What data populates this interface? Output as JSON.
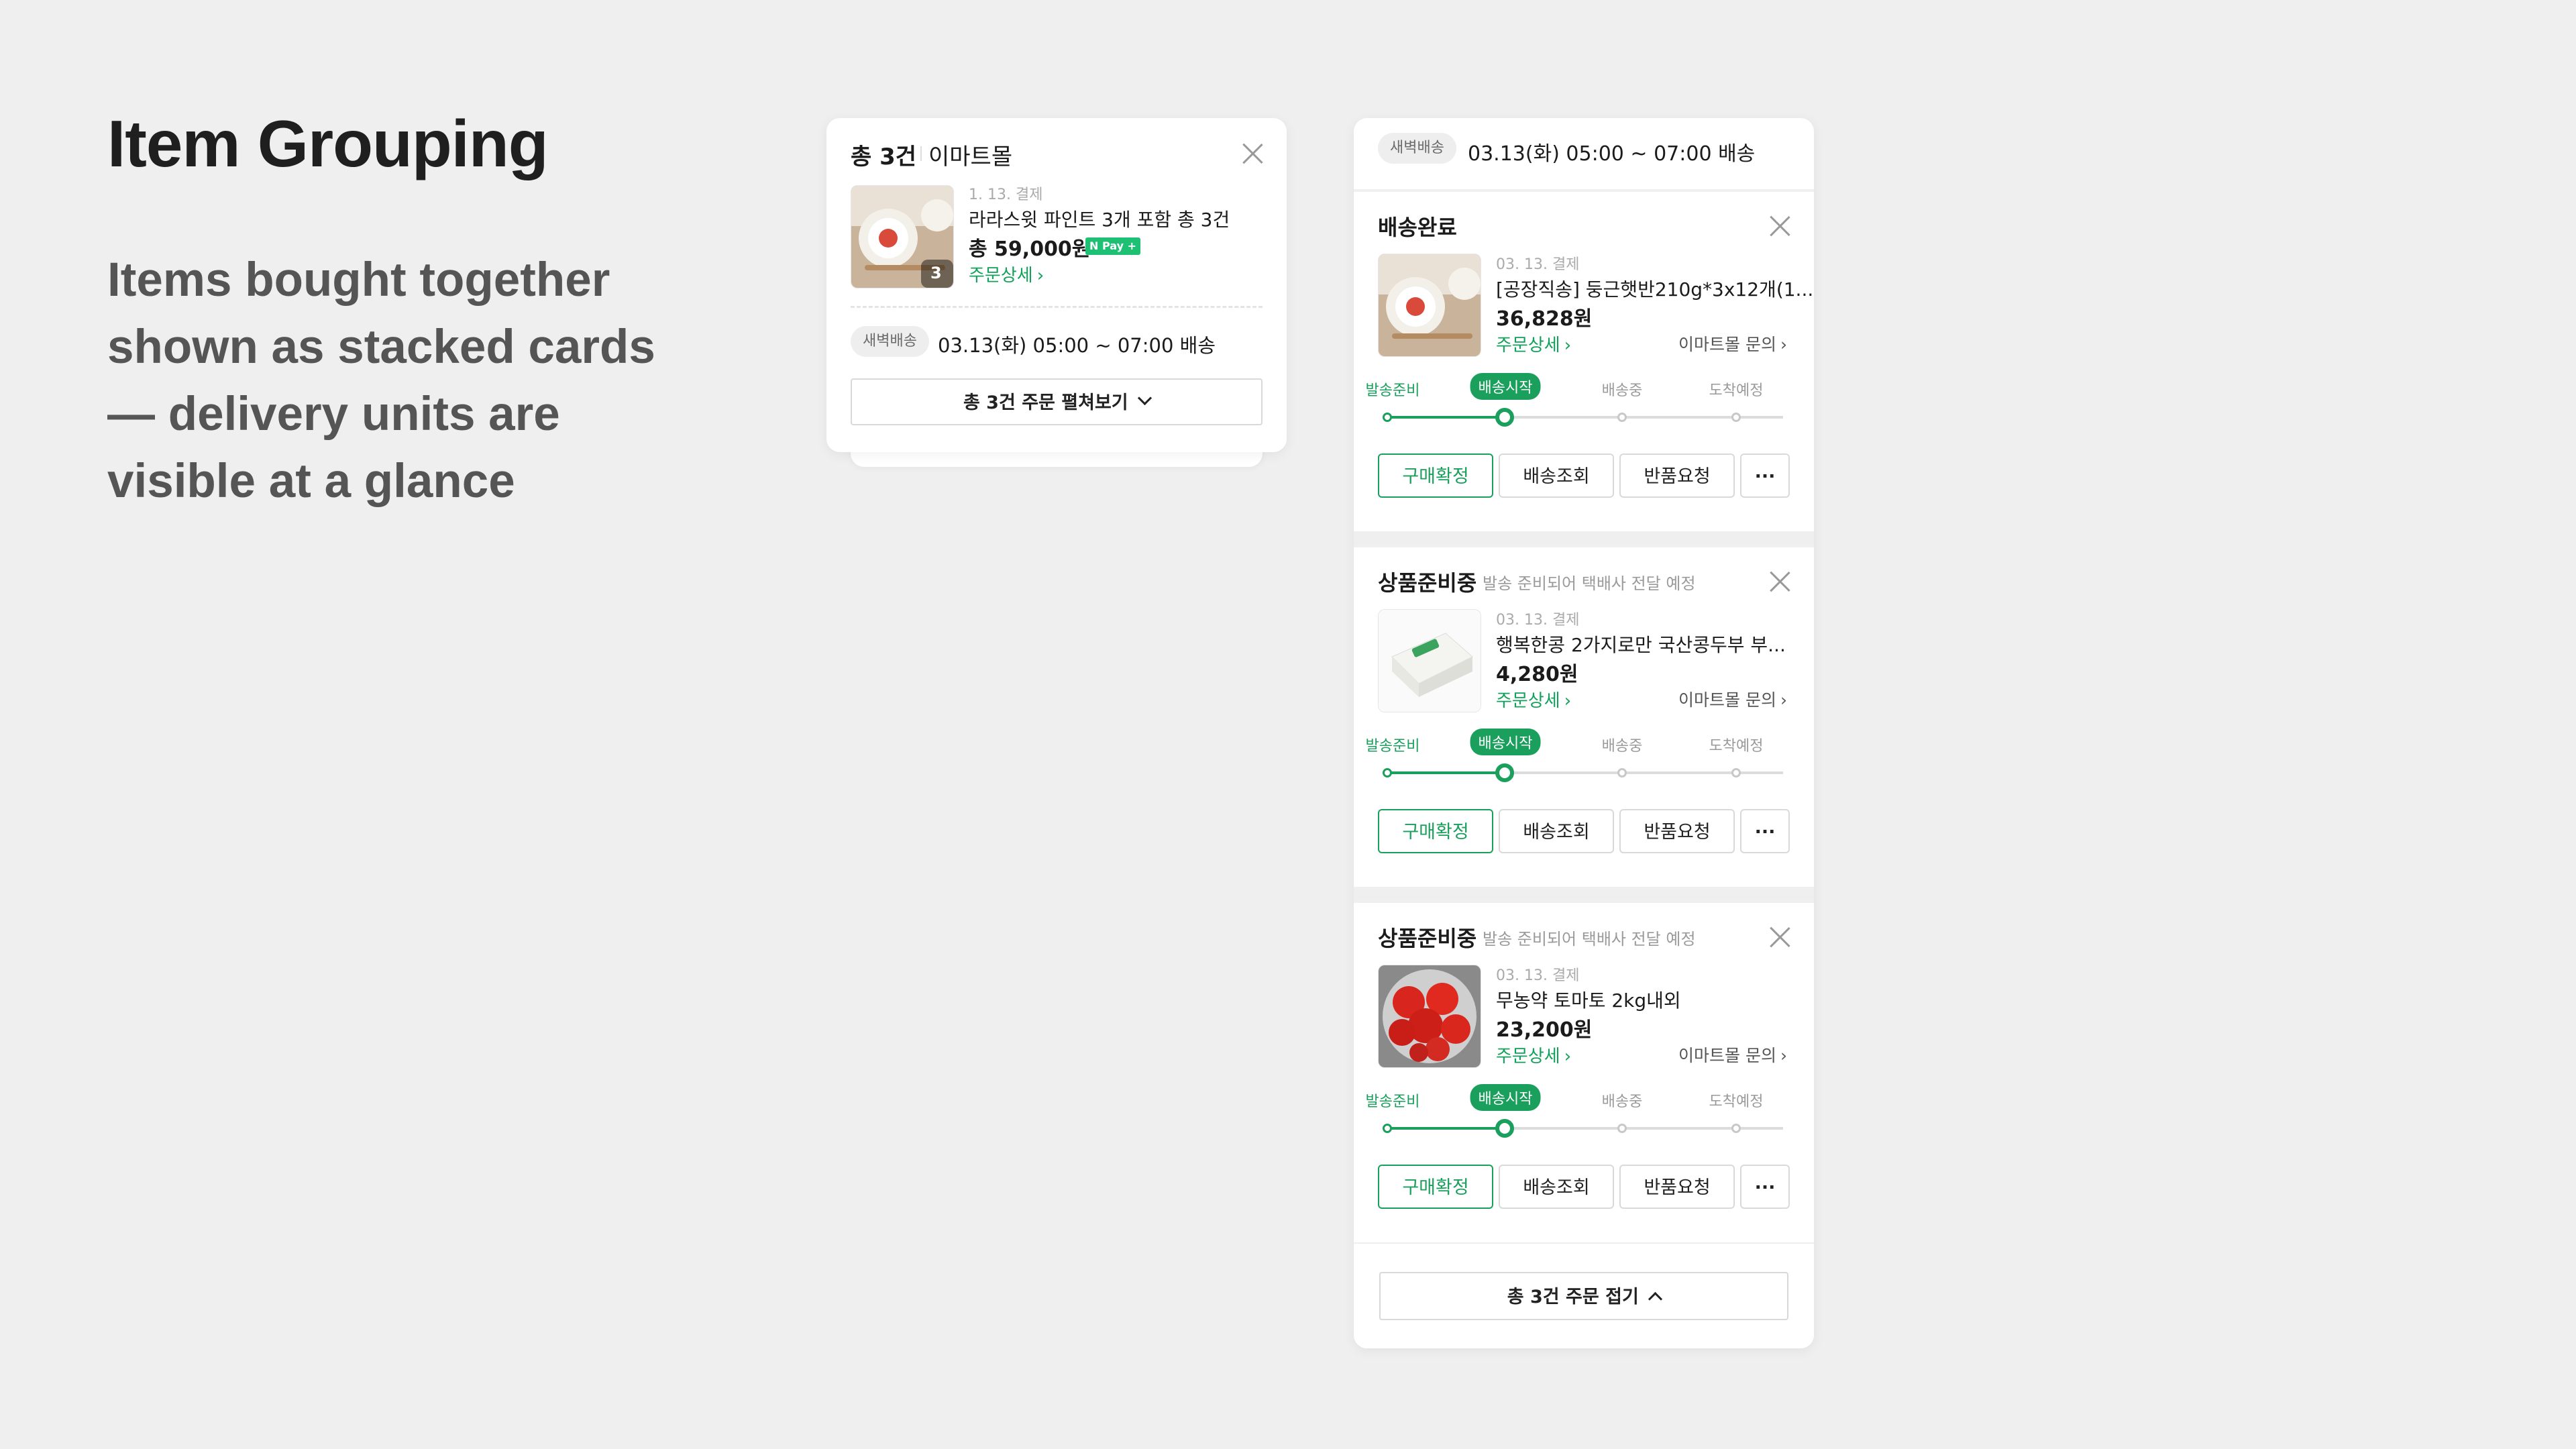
{
  "slide": {
    "heading": "Item Grouping",
    "desc_lines": [
      "Items bought together",
      "shown as stacked cards",
      "— delivery units are",
      "visible at a glance"
    ]
  },
  "collapsed": {
    "count": "총 3건",
    "store": "이마트몰",
    "pay_date": "1. 13. 결제",
    "product": "라라스윗 파인트 3개 포함 총 3건",
    "price": "총 59,000원",
    "npay": "N Pay +",
    "thumb_count": "3",
    "detail": "주문상세",
    "badge": "새벽배송",
    "delivery": "03.13(화) 05:00 ~ 07:00 배송",
    "expand": "총 3건 주문 펼쳐보기"
  },
  "expanded": {
    "badge": "새벽배송",
    "delivery": "03.13(화) 05:00 ~ 07:00 배송",
    "steps": [
      "발송준비",
      "배송시작",
      "배송중",
      "도착예정"
    ],
    "buttons": [
      "구매확정",
      "배송조회",
      "반품요청",
      "···"
    ],
    "detail": "주문상세",
    "inquiry": "이마트몰 문의",
    "items": [
      {
        "status": "배송완료",
        "sub": "",
        "pay_date": "03. 13. 결제",
        "name": "[공장직송] 둥근햇반210g*3x12개(1...",
        "price": "36,828원"
      },
      {
        "status": "상품준비중",
        "sub": "발송 준비되어 택배사 전달 예정",
        "pay_date": "03. 13. 결제",
        "name": "행복한콩 2가지로만 국산콩두부 부...",
        "price": "4,280원"
      },
      {
        "status": "상품준비중",
        "sub": "발송 준비되어 택배사 전달 예정",
        "pay_date": "03. 13. 결제",
        "name": "무농약 토마토 2kg내외",
        "price": "23,200원"
      }
    ],
    "collapse": "총 3건 주문 접기"
  }
}
